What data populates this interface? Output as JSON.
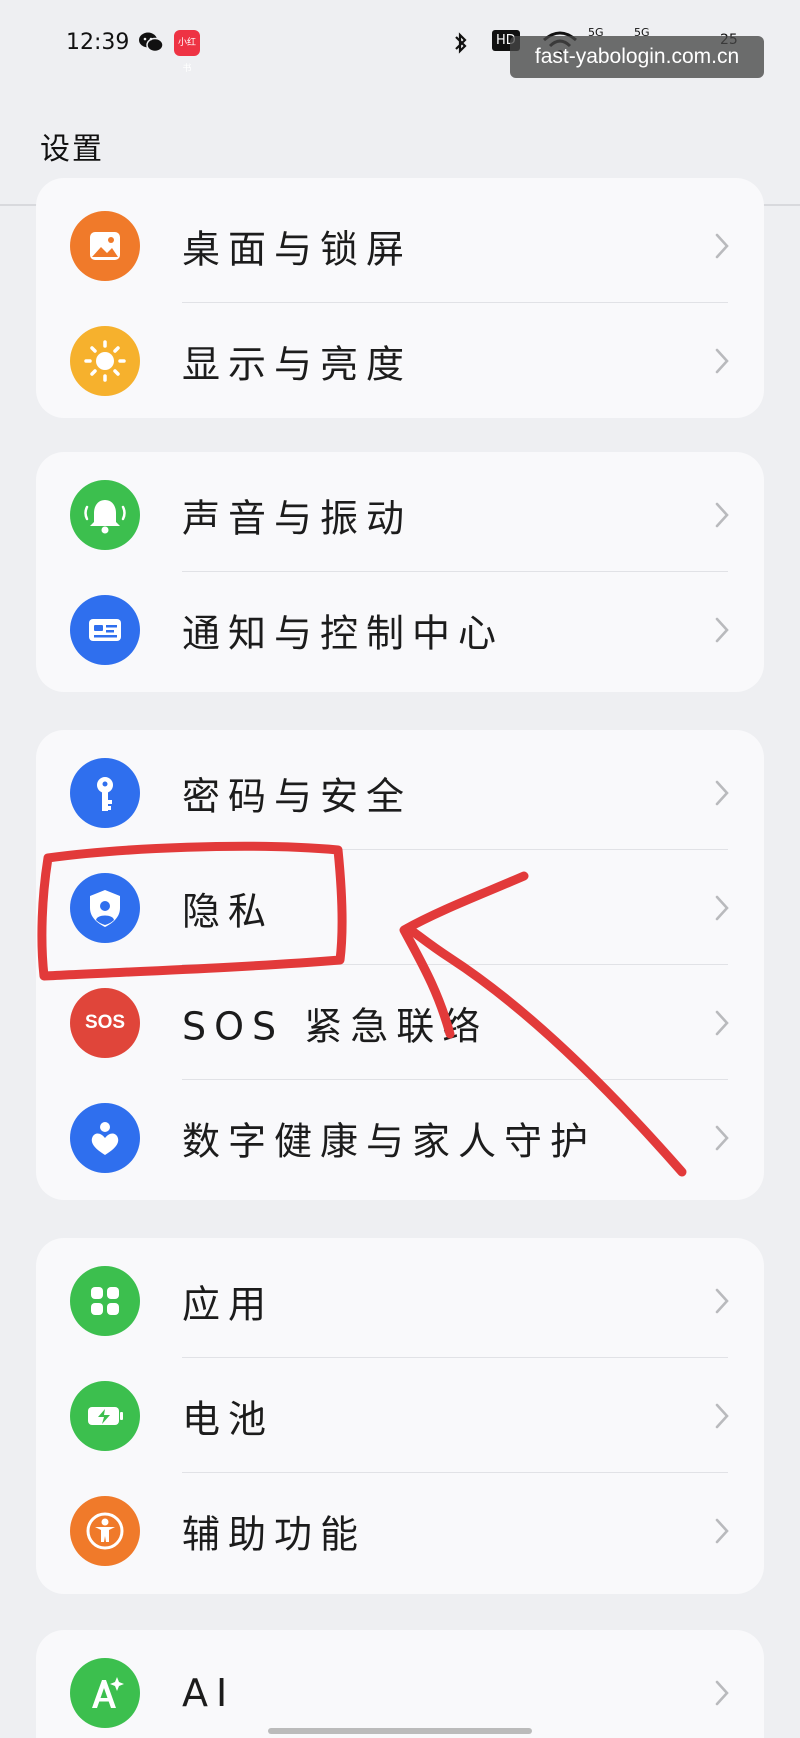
{
  "status_bar": {
    "time": "12:39",
    "apps": [
      "wechat-icon",
      "xiaohongshu-icon"
    ],
    "xhs_label": "小红书",
    "icons": [
      "bluetooth-icon",
      "hd-icon",
      "wifi-icon",
      "5g-signal-icon",
      "5g-signal-icon",
      "battery-icon"
    ],
    "hd": "HD",
    "sig1": "5G",
    "sig2": "5G",
    "battery": "25"
  },
  "watermark": "fast-yabologin.com.cn",
  "header": {
    "title": "设置"
  },
  "groups": [
    {
      "items": [
        {
          "label": "桌面与锁屏",
          "icon": "wallpaper-icon",
          "color": "#f07a2a"
        },
        {
          "label": "显示与亮度",
          "icon": "brightness-icon",
          "color": "#f6b12d"
        }
      ]
    },
    {
      "items": [
        {
          "label": "声音与振动",
          "icon": "bell-icon",
          "color": "#3cbf4e"
        },
        {
          "label": "通知与控制中心",
          "icon": "notification-icon",
          "color": "#2f6fee"
        }
      ]
    },
    {
      "items": [
        {
          "label": "密码与安全",
          "icon": "key-icon",
          "color": "#2f6fee"
        },
        {
          "label": "隐私",
          "icon": "privacy-shield-icon",
          "color": "#2f6fee"
        },
        {
          "label": "SOS 紧急联络",
          "icon": "sos-icon",
          "color": "#e0453a",
          "icon_text": "SOS"
        },
        {
          "label": "数字健康与家人守护",
          "icon": "heart-hand-icon",
          "color": "#2f6fee"
        }
      ]
    },
    {
      "items": [
        {
          "label": "应用",
          "icon": "apps-grid-icon",
          "color": "#3cbf4e"
        },
        {
          "label": "电池",
          "icon": "battery-charge-icon",
          "color": "#3cbf4e"
        },
        {
          "label": "辅助功能",
          "icon": "accessibility-icon",
          "color": "#f07a2a"
        }
      ]
    },
    {
      "items": [
        {
          "label": "AI",
          "icon": "ai-icon",
          "color": "#3cbf4e"
        }
      ]
    }
  ],
  "colors": {
    "annotation_red": "#e23a3a",
    "background": "#eeeff2",
    "card": "#f9f9fb"
  }
}
